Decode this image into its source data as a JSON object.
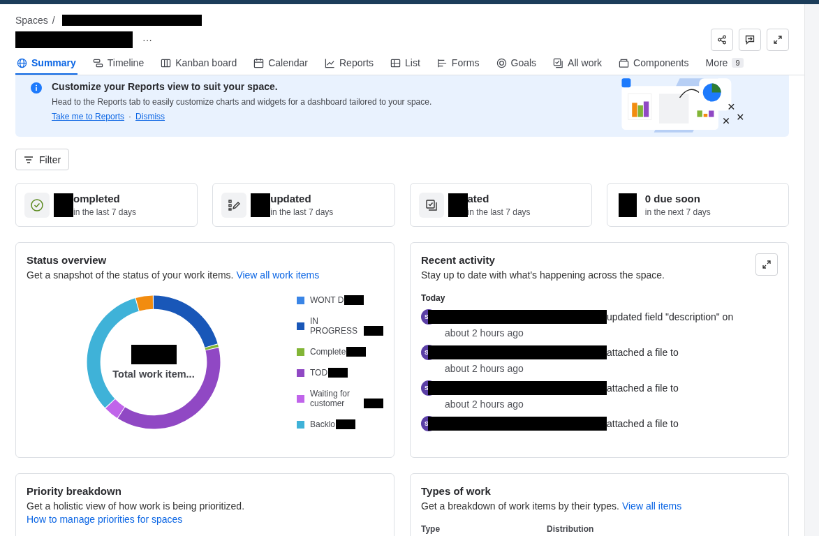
{
  "breadcrumb": {
    "root": "Spaces",
    "separator": "/"
  },
  "header": {
    "more": "···"
  },
  "tabs": [
    {
      "label": "Summary",
      "selected": true
    },
    {
      "label": "Timeline",
      "selected": false
    },
    {
      "label": "Kanban board",
      "selected": false
    },
    {
      "label": "Calendar",
      "selected": false
    },
    {
      "label": "Reports",
      "selected": false
    },
    {
      "label": "List",
      "selected": false
    },
    {
      "label": "Forms",
      "selected": false
    },
    {
      "label": "Goals",
      "selected": false
    },
    {
      "label": "All work",
      "selected": false
    },
    {
      "label": "Components",
      "selected": false
    },
    {
      "label": "More",
      "selected": false,
      "count": "9"
    }
  ],
  "banner": {
    "title": "Customize your Reports view to suit your space.",
    "text": "Head to the Reports tab to easily customize charts and widgets for a dashboard tailored to your space.",
    "links": [
      "Take me to Reports",
      "Dismiss"
    ],
    "separator": "·"
  },
  "filter": {
    "label": "Filter"
  },
  "stats": [
    {
      "kind": "check",
      "title": "ompleted",
      "subtitle": "in the last 7 days"
    },
    {
      "kind": "edit",
      "title": "updated",
      "subtitle": "in the last 7 days"
    },
    {
      "kind": "created",
      "title": "ated",
      "subtitle": "in the last 7 days"
    },
    {
      "kind": "none",
      "title": "0 due soon",
      "subtitle": "in the next 7 days"
    }
  ],
  "status_overview": {
    "title": "Status overview",
    "description": "Get a snapshot of the status of your work items.",
    "link": "View all work items",
    "center_label": "Total work item...",
    "legend": [
      {
        "label": "WONT D",
        "color": "#3a85e6"
      },
      {
        "label": "IN PROGRESS",
        "color": "#1957b8"
      },
      {
        "label": "Complete",
        "color": "#82b536"
      },
      {
        "label": "TOD",
        "color": "#9048c4"
      },
      {
        "label": "Waiting for customer",
        "color": "#c064ea"
      },
      {
        "label": "Backlo",
        "color": "#3fb2d8"
      }
    ]
  },
  "recent_activity": {
    "title": "Recent activity",
    "description": "Stay up to date with what's happening across the space.",
    "day": "Today",
    "items": [
      {
        "avatar": "S",
        "action": "updated field \"description\" on",
        "time": "about 2 hours ago"
      },
      {
        "avatar": "S",
        "action": "attached a file to",
        "time": "about 2 hours ago"
      },
      {
        "avatar": "S",
        "action": "attached a file to",
        "time": "about 2 hours ago"
      },
      {
        "avatar": "S",
        "action": "attached a file to"
      }
    ]
  },
  "priority_breakdown": {
    "title": "Priority breakdown",
    "description": "Get a holistic view of how work is being prioritized.",
    "link": "How to manage priorities for spaces"
  },
  "types_of_work": {
    "title": "Types of work",
    "description": "Get a breakdown of work items by their types.",
    "link": "View all items",
    "columns": [
      "Type",
      "Distribution"
    ]
  }
}
